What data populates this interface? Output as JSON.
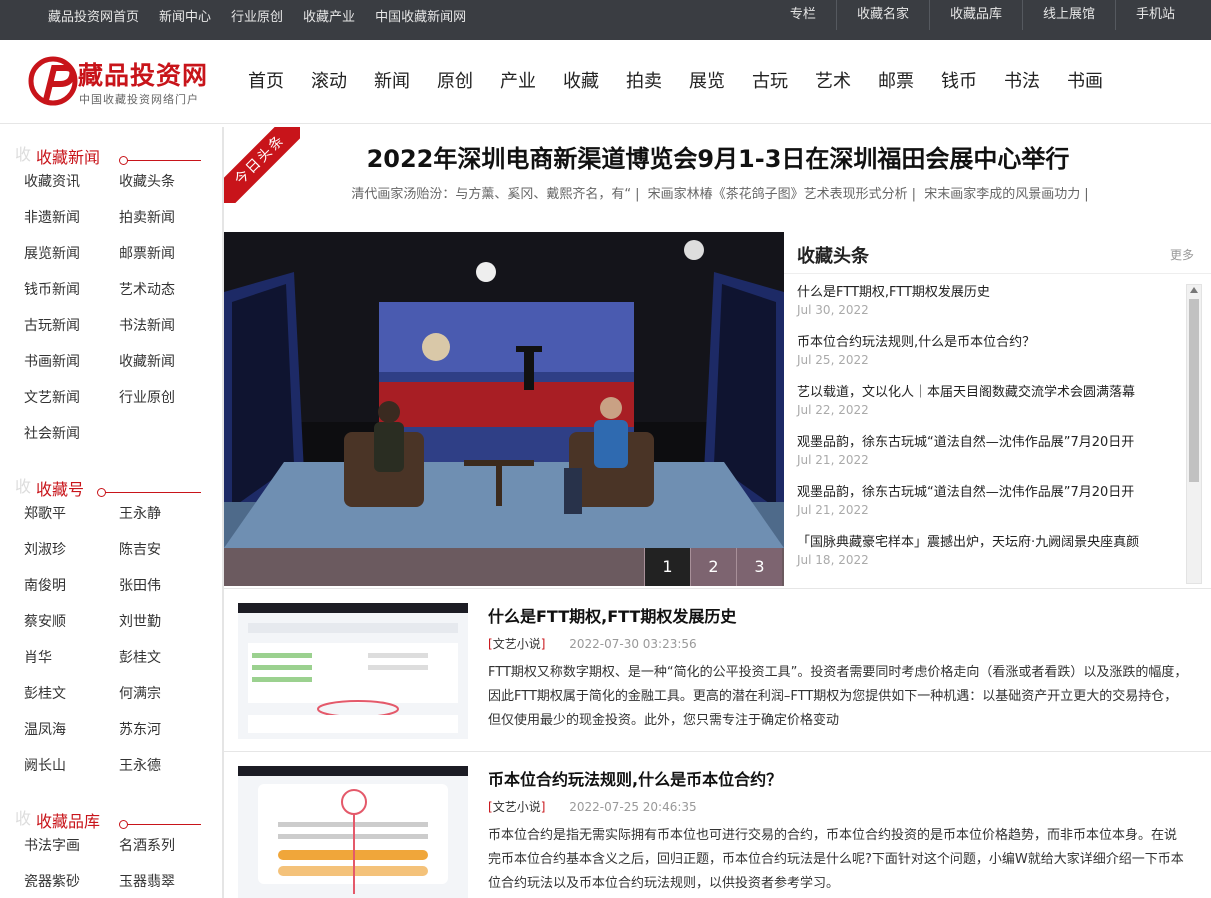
{
  "topbar": {
    "left_links": [
      "藏品投资网首页",
      "新闻中心",
      "行业原创",
      "收藏产业",
      "中国收藏新闻网"
    ],
    "right_links": [
      "专栏",
      "收藏名家",
      "收藏品库",
      "线上展馆",
      "手机站"
    ]
  },
  "logo": {
    "name": "藏品投资网",
    "slogan": "中国收藏投资网络门户"
  },
  "nav": [
    "首页",
    "滚动",
    "新闻",
    "原创",
    "产业",
    "收藏",
    "拍卖",
    "展览",
    "古玩",
    "艺术",
    "邮票",
    "钱币",
    "书法",
    "书画"
  ],
  "sidebar": {
    "sections": [
      {
        "ghost": "收",
        "title": "收藏新闻",
        "links": [
          "收藏资讯",
          "收藏头条",
          "非遗新闻",
          "拍卖新闻",
          "展览新闻",
          "邮票新闻",
          "钱币新闻",
          "艺术动态",
          "古玩新闻",
          "书法新闻",
          "书画新闻",
          "收藏新闻",
          "文艺新闻",
          "行业原创",
          "社会新闻"
        ]
      },
      {
        "ghost": "收",
        "title": "收藏号",
        "links": [
          "郑歌平",
          "王永静",
          "刘淑珍",
          "陈吉安",
          "南俊明",
          "张田伟",
          "蔡安顺",
          "刘世勤",
          "肖华",
          "彭桂文",
          "彭桂文",
          "何满宗",
          "温凤海",
          "苏东河",
          "阙长山",
          "王永德"
        ]
      },
      {
        "ghost": "收",
        "title": "收藏品库",
        "links": [
          "书法字画",
          "名酒系列",
          "瓷器紫砂",
          "玉器翡翠"
        ]
      }
    ]
  },
  "ribbon": "今日头条",
  "headline": {
    "title": "2022年深圳电商新渠道博览会9月1-3日在深圳福田会展中心举行",
    "sublinks": [
      "清代画家汤贻汾：与方薰、奚冈、戴熙齐名，有“",
      "宋画家林椿《茶花鸽子图》艺术表现形式分析",
      "宋末画家李成的风景画功力"
    ]
  },
  "slider": {
    "pages": [
      "1",
      "2",
      "3"
    ],
    "active": "1"
  },
  "headlines_panel": {
    "title": "收藏头条",
    "more": "更多",
    "items": [
      {
        "title": "什么是FTT期权,FTT期权发展历史",
        "date": "Jul 30, 2022"
      },
      {
        "title": "币本位合约玩法规则,什么是币本位合约？",
        "date": "Jul 25, 2022"
      },
      {
        "title": "艺以载道，文以化人｜本届天目阁数藏交流学术会圆满落幕",
        "date": "Jul 22, 2022"
      },
      {
        "title": "观墨品韵，徐东古玩城“道法自然—沈伟作品展”7月20日开",
        "date": "Jul 21, 2022"
      },
      {
        "title": "观墨品韵，徐东古玩城“道法自然—沈伟作品展”7月20日开",
        "date": "Jul 21, 2022"
      },
      {
        "title": "「国脉典藏豪宅样本」震撼出炉，天坛府·九阙阔景央座真颜",
        "date": "Jul 18, 2022"
      }
    ]
  },
  "articles": [
    {
      "title": "什么是FTT期权,FTT期权发展历史",
      "tag_open": "[",
      "tag": "文艺小说",
      "tag_close": "]",
      "time": "2022-07-30 03:23:56",
      "summary": "FTT期权又称数字期权、是一种“简化的公平投资工具”。投资者需要同时考虑价格走向（看涨或者看跌）以及涨跌的幅度，因此FTT期权属于简化的金融工具。更高的潜在利润–FTT期权为您提供如下一种机遇：以基础资产开立更大的交易持仓，但仅使用最少的现金投资。此外，您只需专注于确定价格变动"
    },
    {
      "title": "币本位合约玩法规则,什么是币本位合约？",
      "tag_open": "[",
      "tag": "文艺小说",
      "tag_close": "]",
      "time": "2022-07-25 20:46:35",
      "summary": "币本位合约是指无需实际拥有币本位也可进行交易的合约，币本位合约投资的是币本位价格趋势，而非币本位本身。在说完币本位合约基本含义之后，回归正题，币本位合约玩法是什么呢?下面针对这个问题，小编W就给大家详细介绍一下币本位合约玩法以及币本位合约玩法规则，以供投资者参考学习。"
    }
  ],
  "colors": {
    "brand_red": "#c8141a",
    "topbar_bg": "#3a3d42"
  }
}
